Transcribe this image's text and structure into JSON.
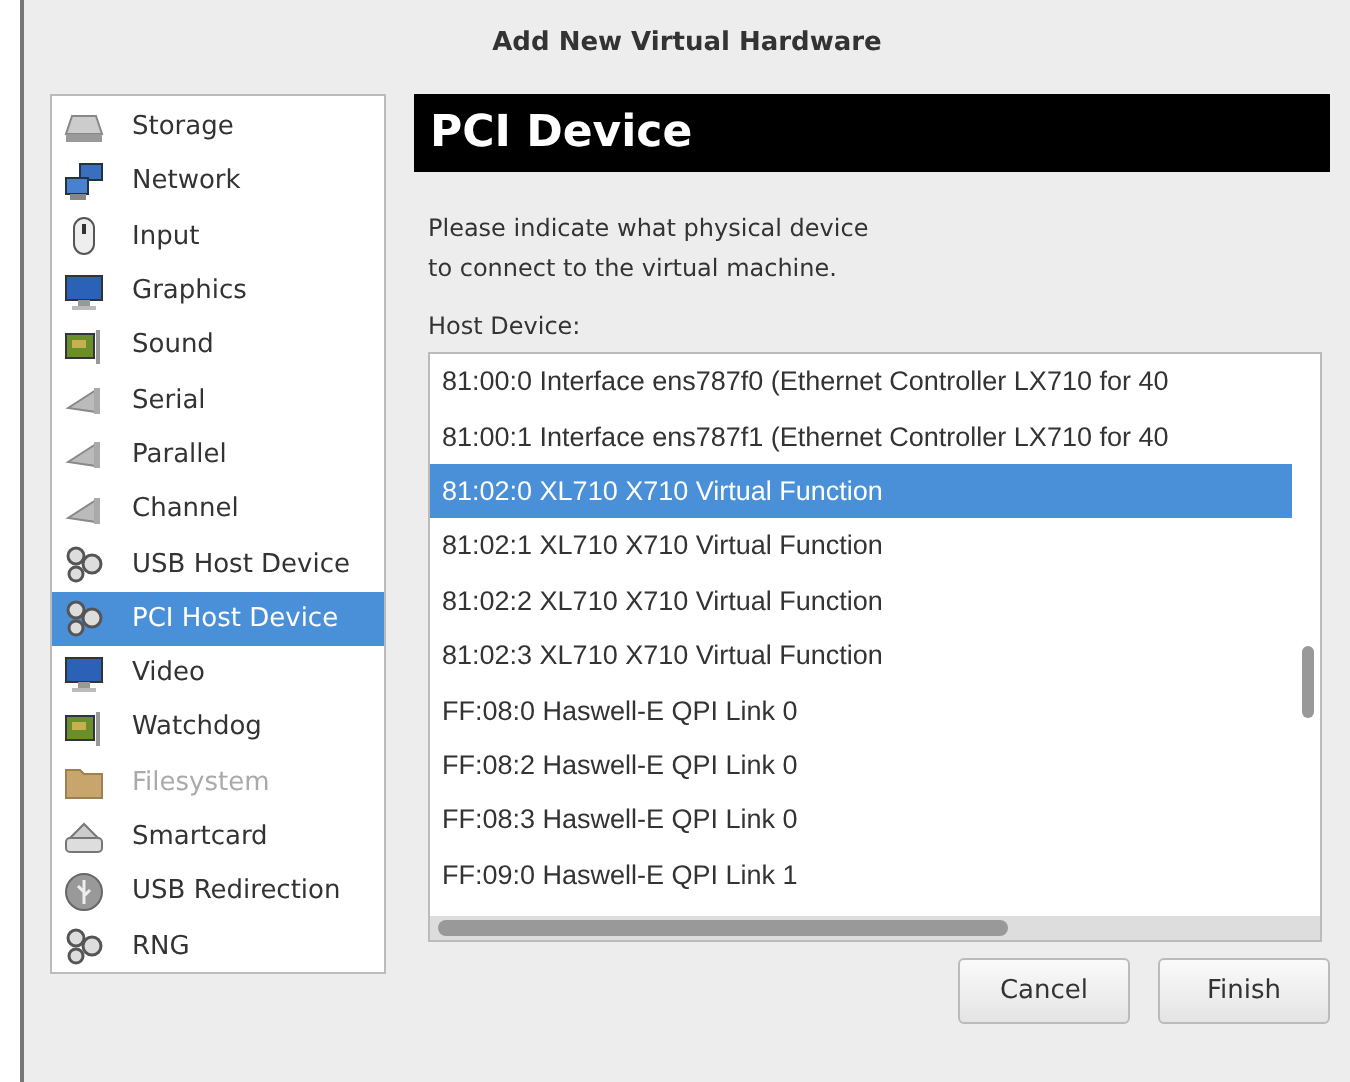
{
  "window": {
    "title": "Add New Virtual Hardware"
  },
  "sidebar": {
    "items": [
      {
        "label": "Storage",
        "kind": "disk",
        "selected": false,
        "disabled": false
      },
      {
        "label": "Network",
        "kind": "network",
        "selected": false,
        "disabled": false
      },
      {
        "label": "Input",
        "kind": "mouse",
        "selected": false,
        "disabled": false
      },
      {
        "label": "Graphics",
        "kind": "monitor",
        "selected": false,
        "disabled": false
      },
      {
        "label": "Sound",
        "kind": "card",
        "selected": false,
        "disabled": false
      },
      {
        "label": "Serial",
        "kind": "plug",
        "selected": false,
        "disabled": false
      },
      {
        "label": "Parallel",
        "kind": "plug",
        "selected": false,
        "disabled": false
      },
      {
        "label": "Channel",
        "kind": "plug",
        "selected": false,
        "disabled": false
      },
      {
        "label": "USB Host Device",
        "kind": "gears",
        "selected": false,
        "disabled": false
      },
      {
        "label": "PCI Host Device",
        "kind": "gears",
        "selected": true,
        "disabled": false
      },
      {
        "label": "Video",
        "kind": "monitor",
        "selected": false,
        "disabled": false
      },
      {
        "label": "Watchdog",
        "kind": "card",
        "selected": false,
        "disabled": false
      },
      {
        "label": "Filesystem",
        "kind": "folder",
        "selected": false,
        "disabled": true
      },
      {
        "label": "Smartcard",
        "kind": "reader",
        "selected": false,
        "disabled": false
      },
      {
        "label": "USB Redirection",
        "kind": "usb",
        "selected": false,
        "disabled": false
      },
      {
        "label": "RNG",
        "kind": "gears",
        "selected": false,
        "disabled": false
      }
    ]
  },
  "page": {
    "heading": "PCI Device",
    "description_lines": [
      "Please indicate what physical device",
      "to connect to the virtual machine."
    ],
    "host_device": {
      "label": "Host Device:",
      "rows": [
        {
          "text": "81:00:0 Interface ens787f0 (Ethernet Controller LX710 for 40",
          "selected": false
        },
        {
          "text": "81:00:1 Interface ens787f1 (Ethernet Controller LX710 for 40",
          "selected": false
        },
        {
          "text": "81:02:0 XL710 X710 Virtual Function",
          "selected": true
        },
        {
          "text": "81:02:1 XL710 X710 Virtual Function",
          "selected": false
        },
        {
          "text": "81:02:2 XL710 X710 Virtual Function",
          "selected": false
        },
        {
          "text": "81:02:3 XL710 X710 Virtual Function",
          "selected": false
        },
        {
          "text": "FF:08:0 Haswell-E QPI Link 0",
          "selected": false
        },
        {
          "text": "FF:08:2 Haswell-E QPI Link 0",
          "selected": false
        },
        {
          "text": "FF:08:3 Haswell-E QPI Link 0",
          "selected": false
        },
        {
          "text": "FF:09:0 Haswell-E QPI Link 1",
          "selected": false
        }
      ]
    }
  },
  "buttons": [
    "Cancel",
    "Finish"
  ]
}
